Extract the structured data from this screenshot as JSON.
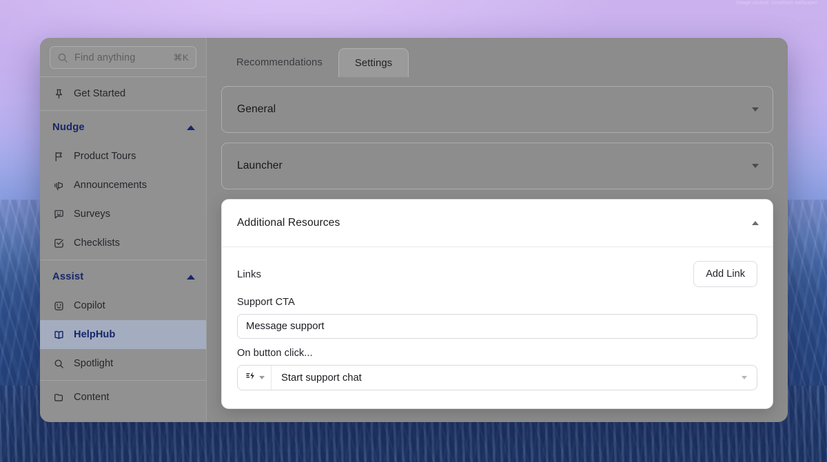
{
  "wallpaper": {
    "watermark": "Image source: Unsplash wallpaper"
  },
  "sidebar": {
    "search": {
      "placeholder": "Find anything",
      "shortcut": "⌘K",
      "icon": "search-icon"
    },
    "top_items": [
      {
        "label": "Get Started",
        "icon": "pin-icon",
        "selected": false
      }
    ],
    "sections": [
      {
        "title": "Nudge",
        "expanded": true,
        "chevron": "chevron-up-icon",
        "items": [
          {
            "label": "Product Tours",
            "icon": "flag-icon",
            "selected": false
          },
          {
            "label": "Announcements",
            "icon": "megaphone-icon",
            "selected": false
          },
          {
            "label": "Surveys",
            "icon": "chat-smile-icon",
            "selected": false
          },
          {
            "label": "Checklists",
            "icon": "checkbox-icon",
            "selected": false
          }
        ]
      },
      {
        "title": "Assist",
        "expanded": true,
        "chevron": "chevron-up-icon",
        "items": [
          {
            "label": "Copilot",
            "icon": "robot-face-icon",
            "selected": false
          },
          {
            "label": "HelpHub",
            "icon": "book-open-icon",
            "selected": true
          },
          {
            "label": "Spotlight",
            "icon": "search-icon",
            "selected": false
          }
        ]
      }
    ],
    "bottom_items": [
      {
        "label": "Content",
        "icon": "folder-icon",
        "selected": false
      }
    ]
  },
  "main": {
    "tabs": [
      {
        "label": "Recommendations",
        "active": false
      },
      {
        "label": "Settings",
        "active": true
      }
    ],
    "panels": [
      {
        "title": "General",
        "expanded": false,
        "chevron": "chevron-down-icon"
      },
      {
        "title": "Launcher",
        "expanded": false,
        "chevron": "chevron-down-icon"
      },
      {
        "title": "Additional Resources",
        "expanded": true,
        "chevron": "chevron-up-icon"
      }
    ],
    "additional_resources": {
      "links_label": "Links",
      "add_link_label": "Add Link",
      "support_cta_label": "Support CTA",
      "support_cta_value": "Message support",
      "support_cta_placeholder": "Message support",
      "on_click_label": "On button click...",
      "action_icon": "zap-action-icon",
      "action_value": "Start support chat"
    }
  },
  "colors": {
    "accent": "#17266b",
    "selected_row_bg": "#a4adbf",
    "card_bg": "#ffffff",
    "dim_overlay": "#8e8e8e"
  }
}
